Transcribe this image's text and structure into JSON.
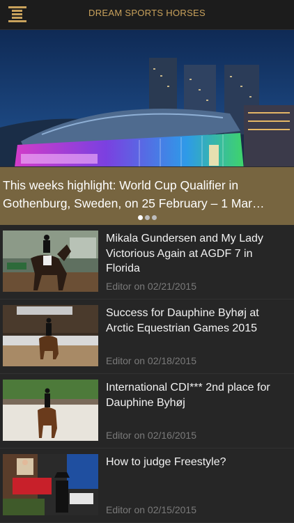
{
  "header": {
    "title": "DREAM SPORTS HORSES",
    "menu_icon": "hamburger-menu-icon"
  },
  "hero": {
    "title": "This weeks highlight: World Cup Qualifier in Gothenburg, Sweden, on 25 February – 1 Mar…",
    "carousel_pages": 3,
    "active_page": 1
  },
  "news": [
    {
      "title": "Mikala Gundersen and My Lady Victorious Again at AGDF 7 in Florida",
      "meta": "Editor on 02/21/2015"
    },
    {
      "title": "Success for Dauphine Byhøj at Arctic Equestrian Games 2015",
      "meta": "Editor on 02/18/2015"
    },
    {
      "title": "International CDI*** 2nd place for Dauphine Byhøj",
      "meta": "Editor on 02/16/2015"
    },
    {
      "title": "How to judge Freestyle?",
      "meta": "Editor on 02/15/2015"
    }
  ],
  "colors": {
    "accent": "#c9a25c",
    "background": "#262626",
    "caption_overlay": "#806c42"
  }
}
